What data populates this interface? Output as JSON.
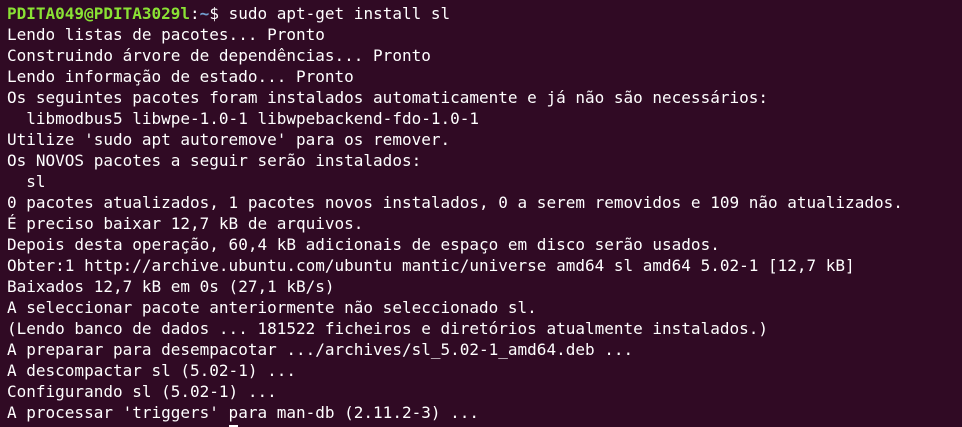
{
  "prompt": {
    "user_host": "PDITA049@PDITA3029l",
    "separator": ":",
    "path": "~",
    "symbol": "$ ",
    "command": "sudo apt-get install sl"
  },
  "output": [
    "Lendo listas de pacotes... Pronto",
    "Construindo árvore de dependências... Pronto",
    "Lendo informação de estado... Pronto",
    "Os seguintes pacotes foram instalados automaticamente e já não são necessários:",
    "  libmodbus5 libwpe-1.0-1 libwpebackend-fdo-1.0-1",
    "Utilize 'sudo apt autoremove' para os remover.",
    "Os NOVOS pacotes a seguir serão instalados:",
    "  sl",
    "0 pacotes atualizados, 1 pacotes novos instalados, 0 a serem removidos e 109 não atualizados.",
    "É preciso baixar 12,7 kB de arquivos.",
    "Depois desta operação, 60,4 kB adicionais de espaço em disco serão usados.",
    "Obter:1 http://archive.ubuntu.com/ubuntu mantic/universe amd64 sl amd64 5.02-1 [12,7 kB]",
    "Baixados 12,7 kB em 0s (27,1 kB/s)",
    "A seleccionar pacote anteriormente não seleccionado sl.",
    "(Lendo banco de dados ... 181522 ficheiros e diretórios atualmente instalados.)",
    "A preparar para desempacotar .../archives/sl_5.02-1_amd64.deb ...",
    "A descompactar sl (5.02-1) ...",
    "Configurando sl (5.02-1) ...",
    "A processar 'triggers' para man-db (2.11.2-3) ..."
  ],
  "colors": {
    "background": "#300a24",
    "text": "#ffffff",
    "user": "#8ae234",
    "path": "#729fcf"
  }
}
